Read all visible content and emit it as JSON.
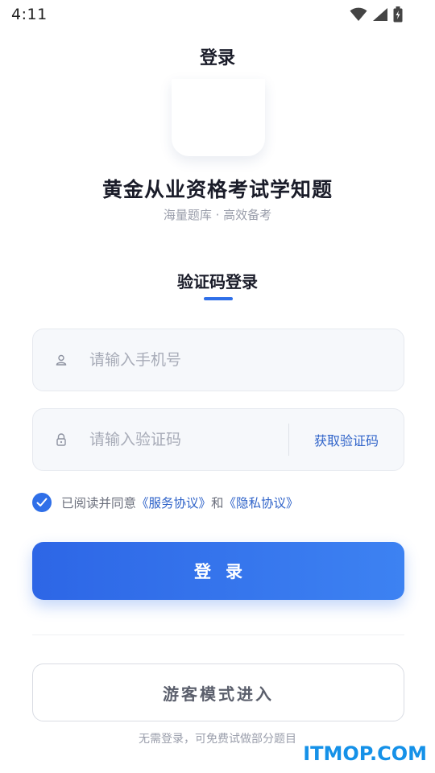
{
  "status_bar": {
    "time": "4:11",
    "icons": [
      "wifi-icon",
      "signal-icon",
      "battery-charging-icon"
    ]
  },
  "header": {
    "title": "登录"
  },
  "app": {
    "name": "黄金从业资格考试学知题",
    "slogan": "海量题库 · 高效备考"
  },
  "login_tab": {
    "label": "验证码登录"
  },
  "form": {
    "phone": {
      "placeholder": "请输入手机号",
      "value": "",
      "icon": "user-icon"
    },
    "code": {
      "placeholder": "请输入验证码",
      "value": "",
      "icon": "lock-icon",
      "get_code_label": "获取验证码"
    }
  },
  "agreement": {
    "checked": true,
    "prefix": "已阅读并同意",
    "service_link": "《服务协议》",
    "and": "和",
    "privacy_link": "《隐私协议》"
  },
  "buttons": {
    "login_label": "登录",
    "guest_label": "游客模式进入",
    "guest_hint": "无需登录，可免费试做部分题目"
  },
  "watermark": "ITMOP.COM",
  "colors": {
    "accent": "#2f6fe8",
    "link": "#2f63c9",
    "watermark": "#1591e8"
  }
}
